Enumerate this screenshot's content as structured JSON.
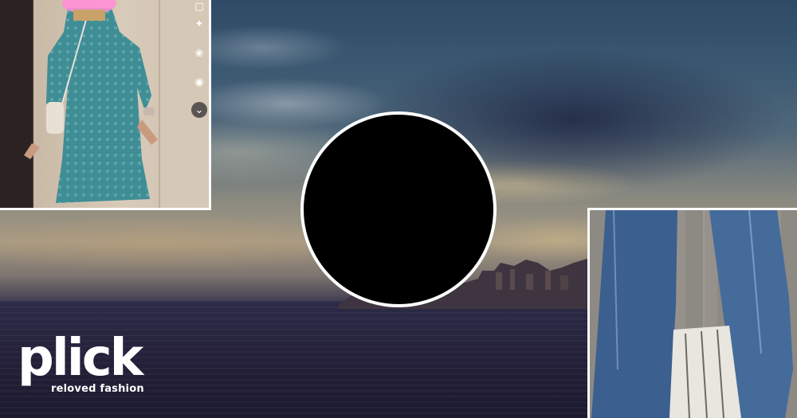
{
  "logo": {
    "word": "plick",
    "tagline": "reloved fashion"
  },
  "side_icons": [
    "sparkle-square-icon",
    "circles-filter-icon",
    "pin-icon",
    "chevron-down-icon"
  ],
  "colors": {
    "logo": "#ffffff",
    "frame": "#ffffff",
    "disc": "#000000",
    "dress": "#3f8e95",
    "jeans": "#3b5f8f"
  }
}
